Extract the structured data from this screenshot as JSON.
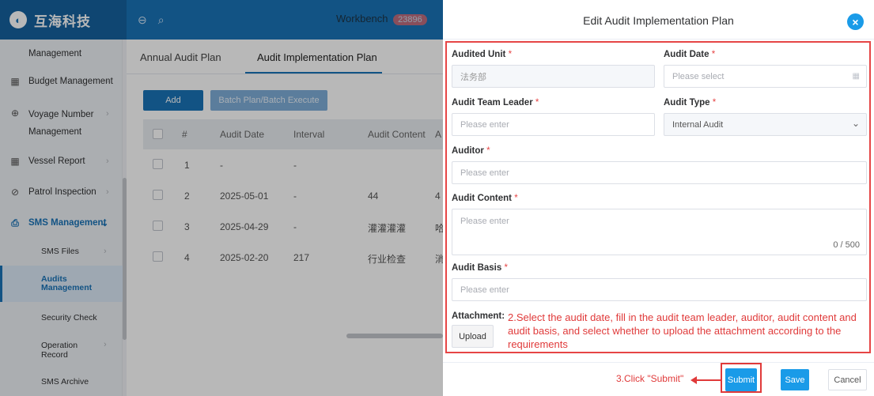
{
  "header": {
    "logo_text": "互海科技",
    "workbench_label": "Workbench",
    "workbench_count": "23896"
  },
  "sidebar": {
    "items": [
      {
        "label": "Management",
        "icon": "none"
      },
      {
        "label": "Budget Management",
        "icon": "budget-icon"
      },
      {
        "label": "Voyage Number",
        "label2": "Management",
        "icon": "globe-icon"
      },
      {
        "label": "Vessel Report",
        "icon": "report-icon"
      },
      {
        "label": "Patrol Inspection",
        "icon": "check-circle-icon"
      },
      {
        "label": "SMS Management",
        "icon": "document-icon"
      }
    ],
    "subitems": [
      {
        "label": "SMS Files"
      },
      {
        "label": "Audits",
        "label2": "Management"
      },
      {
        "label": "Security Check"
      },
      {
        "label": "Operation",
        "label2": "Record"
      },
      {
        "label": "SMS Archive"
      }
    ]
  },
  "main": {
    "tabs": [
      "Annual Audit Plan",
      "Audit Implementation Plan"
    ],
    "add_label": "Add",
    "batch_label": "Batch Plan/Batch Execute",
    "columns": [
      "#",
      "Audit Date",
      "Interval",
      "Audit Content",
      "A"
    ],
    "rows": [
      {
        "num": "1",
        "date": "-",
        "interval": "-",
        "content": "",
        "extra": ""
      },
      {
        "num": "2",
        "date": "2025-05-01",
        "interval": "-",
        "content": "44",
        "extra": "4"
      },
      {
        "num": "3",
        "date": "2025-04-29",
        "interval": "-",
        "content": "灌灌灌灌",
        "extra": "哈"
      },
      {
        "num": "4",
        "date": "2025-02-20",
        "interval": "217",
        "content": "行业检查",
        "extra": "消"
      }
    ]
  },
  "drawer": {
    "title": "Edit Audit Implementation Plan",
    "required_mark": "*",
    "fields": {
      "audited_unit": {
        "label": "Audited Unit",
        "value": "法务部"
      },
      "audit_date": {
        "label": "Audit Date",
        "placeholder": "Please select"
      },
      "team_leader": {
        "label": "Audit Team Leader",
        "placeholder": "Please enter"
      },
      "audit_type": {
        "label": "Audit Type",
        "value": "Internal Audit"
      },
      "auditor": {
        "label": "Auditor",
        "placeholder": "Please enter"
      },
      "audit_content": {
        "label": "Audit Content",
        "placeholder": "Please enter",
        "counter": "0 / 500"
      },
      "audit_basis": {
        "label": "Audit Basis",
        "placeholder": "Please enter"
      },
      "attachment": {
        "label": "Attachment:",
        "upload_label": "Upload"
      }
    },
    "annotation_2": "2.Select the audit date, fill in the audit team leader, auditor, audit content and audit basis, and select whether to upload the attachment according to the requirements",
    "annotation_3": "3.Click \"Submit\"",
    "submit_label": "Submit",
    "save_label": "Save",
    "cancel_label": "Cancel"
  }
}
